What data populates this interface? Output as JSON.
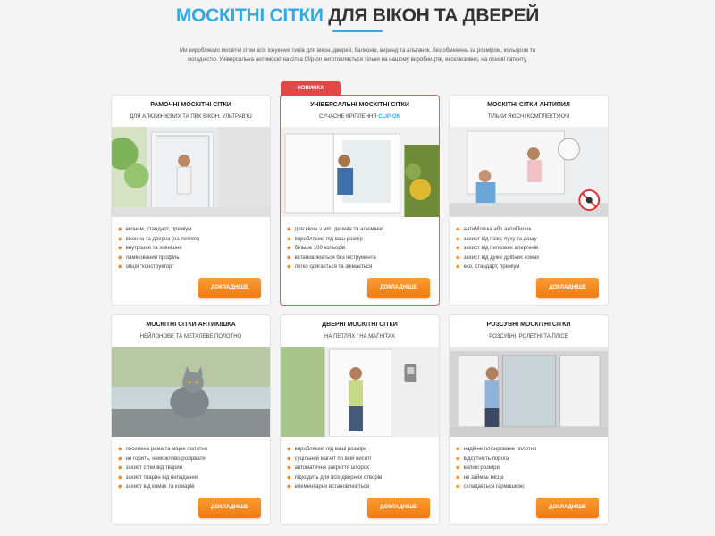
{
  "header": {
    "title_accent": "МОСКІТНІ СІТКИ",
    "title_rest": "ДЛЯ ВІКОН ТА ДВЕРЕЙ",
    "intro": "Ми виробляємо москітні сітки всіх існуючих типів для вікон, дверей, балконів, веранд та альтанок, без обмежень за розміром, кольором та складністю. Універсальна антимоскітна сітка Clip-on виготовляється тільки на нашому виробництві, ексклюзивно, на основі патенту."
  },
  "colors": {
    "accent": "#35a9df",
    "button": "#f08a1e",
    "ribbon": "#e04848"
  },
  "cards": [
    {
      "title": "РАМОЧНІ МОСКІТНІ СІТКИ",
      "subtitle": "ДЛЯ АЛЮМІНІЄВИХ ТА ПВХ ВІКОН, УЛЬТРАВ'Ю",
      "features": [
        "економ, стандарт, преміум",
        "віконна та дверна (на петлях)",
        "внутрішня та зовнішня",
        "ламінований профіль",
        "опція \"конструктор\""
      ],
      "button": "ДОКЛАДНІШЕ"
    },
    {
      "ribbon": "НОВИНКА",
      "title": "УНІВЕРСАЛЬНІ МОСКІТНІ СІТКИ",
      "subtitle": "СУЧАСНЕ КРІПЛЕННЯ",
      "subtitle_hl": "CLIP-ON",
      "features": [
        "для вікон з м/п, дерева та алюмінію",
        "виробляємо під ваш розмір",
        "більше 100 кольорів",
        "встановлюється без інструмента",
        "легко одягається та знімається"
      ],
      "button": "ДОКЛАДНІШЕ"
    },
    {
      "title": "МОСКІТНІ СІТКИ АНТИПИЛ",
      "subtitle": "ТІЛЬКИ ЯКІСНІ КОМПЛЕКТУЮЧІ",
      "features": [
        "антиМошка або антиПилок",
        "захист від піску, пуху та дощу",
        "захист від пилкових алергенів",
        "захист від дуже дрібних комах",
        "еко, стандарт, преміум"
      ],
      "button": "ДОКЛАДНІШЕ"
    },
    {
      "title": "МОСКІТНІ СІТКИ АНТИКІШКА",
      "subtitle": "НЕЙЛОНОВЕ ТА МЕТАЛЕВЕ ПОЛОТНО",
      "features": [
        "посилена рама та міцне полотно",
        "не горить, неможливо розірвати",
        "захист сітки від тварин",
        "захист тварин від випадання",
        "захист від комах та комарів"
      ],
      "button": "ДОКЛАДНІШЕ"
    },
    {
      "title": "ДВЕРНІ МОСКІТНІ СІТКИ",
      "subtitle": "НА ПЕТЛЯХ / НА МАГНІТАХ",
      "features": [
        "виробляємо під ваші розміри",
        "суцільний магніт по всій висоті",
        "автоматичне закриття шторок",
        "підходить для всіх дверних отворів",
        "елементарно встановлюється"
      ],
      "button": "ДОКЛАДНІШЕ"
    },
    {
      "title": "РОЗСУВНІ МОСКІТНІ СІТКИ",
      "subtitle": "РОЗСУВНІ, РОЛЕТНІ ТА ПЛІСЕ",
      "features": [
        "надійне плісироване полотно",
        "відсутність порога",
        "великі розміри",
        "не займає місце",
        "складається гармошкою"
      ],
      "button": "ДОКЛАДНІШЕ"
    }
  ]
}
